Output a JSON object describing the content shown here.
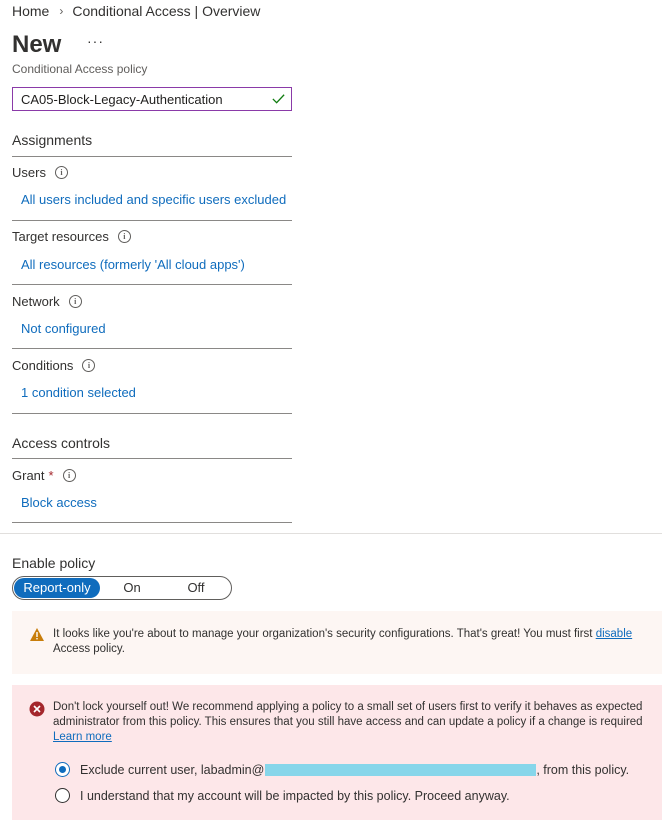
{
  "breadcrumb": {
    "home": "Home",
    "separator": "›",
    "current": "Conditional Access | Overview"
  },
  "header": {
    "title": "New",
    "more": "···",
    "subtitle": "Conditional Access policy"
  },
  "policy_name": {
    "value": "CA05-Block-Legacy-Authentication"
  },
  "assignments": {
    "heading": "Assignments",
    "users": {
      "label": "Users",
      "value": "All users included and specific users excluded"
    },
    "target_resources": {
      "label": "Target resources",
      "value": "All resources (formerly 'All cloud apps')"
    },
    "network": {
      "label": "Network",
      "value": "Not configured"
    },
    "conditions": {
      "label": "Conditions",
      "value": "1 condition selected"
    }
  },
  "access_controls": {
    "heading": "Access controls",
    "grant": {
      "label": "Grant",
      "required": "*",
      "value": "Block access"
    }
  },
  "enable_policy": {
    "label": "Enable policy",
    "options": [
      "Report-only",
      "On",
      "Off"
    ],
    "selected": "Report-only"
  },
  "warning": {
    "line1": "It looks like you're about to manage your organization's security configurations. That's great! You must first ",
    "link": "disable",
    "line2": "Access policy."
  },
  "error": {
    "line1": "Don't lock yourself out! We recommend applying a policy to a small set of users first to verify it behaves as expected",
    "line2": "administrator from this policy. This ensures that you still have access and can update a policy if a change is required",
    "learn_more": "Learn more",
    "option1_prefix": "Exclude current user, labadmin@",
    "option1_suffix": ", from this policy.",
    "option2": "I understand that my account will be impacted by this policy. Proceed anyway."
  },
  "colors": {
    "accent": "#0f6cbd",
    "name_border": "#8a3aa8",
    "warning_bg": "#fdf6f3",
    "error_bg": "#fde7e9",
    "redaction": "#87d6ea"
  },
  "icons": {
    "info": "info-icon",
    "check": "checkmark-icon",
    "warning": "warning-icon",
    "error": "error-icon"
  }
}
